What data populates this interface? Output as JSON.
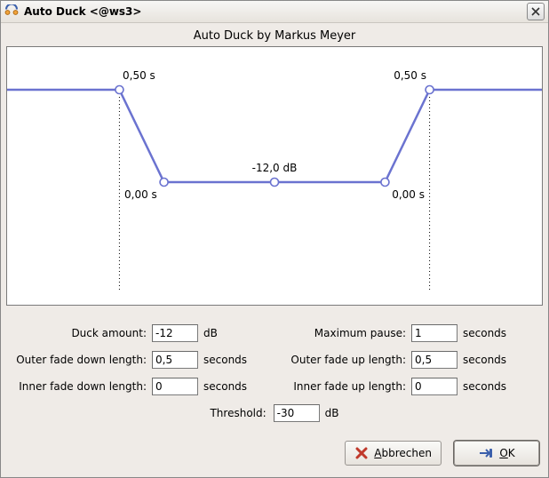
{
  "window": {
    "title": "Auto Duck <@ws3>"
  },
  "heading": "Auto Duck by Markus Meyer",
  "chart_data": {
    "type": "line",
    "x_unit": "s",
    "y_unit": "dB",
    "ylim": [
      -30,
      5
    ],
    "points": [
      {
        "x": -1.0,
        "y": 0
      },
      {
        "x": -0.5,
        "y": 0,
        "label": "0,50 s"
      },
      {
        "x": 0.0,
        "y": -12,
        "label": "0,00 s"
      },
      {
        "x": 1.5,
        "y": -12,
        "label": "-12,0 dB"
      },
      {
        "x": 3.0,
        "y": -12,
        "label": "0,00 s"
      },
      {
        "x": 3.5,
        "y": 0,
        "label": "0,50 s"
      },
      {
        "x": 4.0,
        "y": 0
      }
    ],
    "guides_x": [
      -0.5,
      3.5
    ]
  },
  "graph_labels": {
    "outer_down": "0,50 s",
    "inner_down": "0,00 s",
    "duck": "-12,0 dB",
    "inner_up": "0,00 s",
    "outer_up": "0,50 s"
  },
  "form": {
    "duck_amount": {
      "label": "Duck amount:",
      "value": "-12",
      "unit": "dB"
    },
    "max_pause": {
      "label": "Maximum pause:",
      "value": "1",
      "unit": "seconds"
    },
    "outer_fade_down": {
      "label": "Outer fade down length:",
      "value": "0,5",
      "unit": "seconds"
    },
    "outer_fade_up": {
      "label": "Outer fade up length:",
      "value": "0,5",
      "unit": "seconds"
    },
    "inner_fade_down": {
      "label": "Inner fade down length:",
      "value": "0",
      "unit": "seconds"
    },
    "inner_fade_up": {
      "label": "Inner fade up length:",
      "value": "0",
      "unit": "seconds"
    },
    "threshold": {
      "label": "Threshold:",
      "value": "-30",
      "unit": "dB"
    }
  },
  "buttons": {
    "cancel": "Abbrechen",
    "ok": "OK"
  }
}
